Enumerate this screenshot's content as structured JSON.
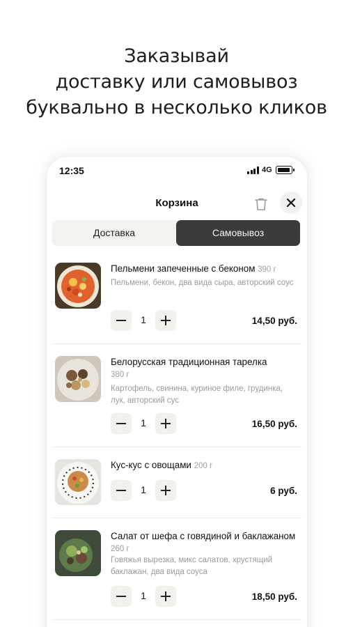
{
  "headline": {
    "line1": "Заказывай",
    "line2": "доставку или самовывоз",
    "line3": "буквально в несколько кликов"
  },
  "status_bar": {
    "time": "12:35",
    "network": "4G"
  },
  "cart": {
    "title": "Корзина",
    "tabs": {
      "delivery": "Доставка",
      "pickup": "Самовывоз",
      "selected": "pickup"
    },
    "items": [
      {
        "name": "Пельмени запеченные с беконом",
        "weight": "390 г",
        "description": "Пельмени, бекон, два вида сыра, авторский соус",
        "quantity": "1",
        "price": "14,50 руб."
      },
      {
        "name": "Белорусская традиционная тарелка",
        "weight": "380 г",
        "description": "Картофель, свинина, куриное филе, грудинка, лук, авторский сус",
        "quantity": "1",
        "price": "16,50 руб."
      },
      {
        "name": "Кус-кус с овощами",
        "weight": "200 г",
        "description": "",
        "quantity": "1",
        "price": "6 руб."
      },
      {
        "name": "Салат от шефа с говядиной и баклажаном",
        "weight": "260 г",
        "description": "Говяжья вырезка, микс салатов, хрустящий баклажан, два вида соуса",
        "quantity": "1",
        "price": "18,50 руб."
      }
    ]
  },
  "colors": {
    "segment_active": "#3b3b3b",
    "segment_bg": "#f3f2ef",
    "stepper_bg": "#f2f1ee",
    "muted_text": "#9a9a9a"
  }
}
